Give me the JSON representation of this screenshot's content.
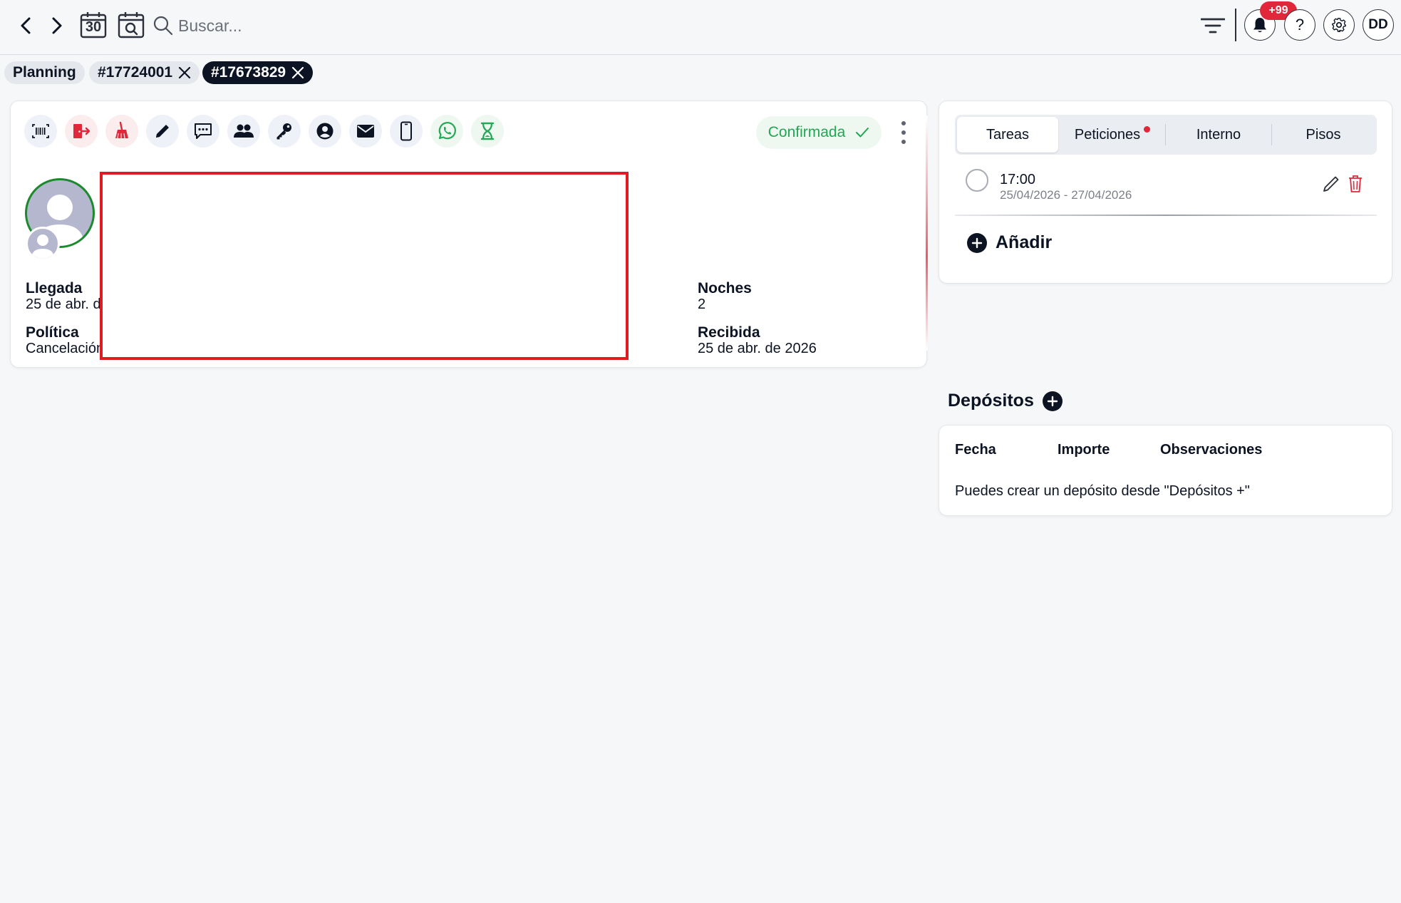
{
  "topbar": {
    "search_placeholder": "Buscar...",
    "calendar_day": "30",
    "notifications_badge": "+99",
    "help_label": "?",
    "user_initials": "DD"
  },
  "tabs": [
    {
      "label": "Planning",
      "active": false,
      "closable": false
    },
    {
      "label": "#17724001",
      "active": false,
      "closable": true
    },
    {
      "label": "#17673829",
      "active": true,
      "closable": true
    }
  ],
  "reservation": {
    "status": "Confirmada",
    "fields": {
      "arrival_label": "Llegada",
      "arrival_value": "25 de abr. d",
      "policy_label": "Política",
      "policy_value": "Cancelación",
      "nights_label": "Noches",
      "nights_value": "2",
      "received_label": "Recibida",
      "received_value": "25 de abr. de 2026"
    },
    "actions": [
      "barcode-icon",
      "checkout-icon",
      "broom-icon",
      "pencil-icon",
      "chat-icon",
      "group-icon",
      "key-icon",
      "user-circle-icon",
      "mail-icon",
      "phone-icon",
      "whatsapp-icon",
      "hourglass-icon"
    ]
  },
  "side_tabs": [
    {
      "label": "Tareas",
      "active": true,
      "dot": false
    },
    {
      "label": "Peticiones",
      "active": false,
      "dot": true
    },
    {
      "label": "Interno",
      "active": false,
      "dot": false
    },
    {
      "label": "Pisos",
      "active": false,
      "dot": false
    }
  ],
  "tasks": [
    {
      "time": "17:00",
      "dates": "25/04/2026 - 27/04/2026"
    }
  ],
  "add_label": "Añadir",
  "deposits": {
    "title": "Depósitos",
    "columns": [
      "Fecha",
      "Importe",
      "Observaciones"
    ],
    "empty_message": "Puedes crear un depósito desde \"Depósitos +\""
  },
  "colors": {
    "primary": "#0c1322",
    "accent_red": "#e0283a",
    "success_green": "#22a653",
    "whatsapp_green": "#25a857"
  }
}
